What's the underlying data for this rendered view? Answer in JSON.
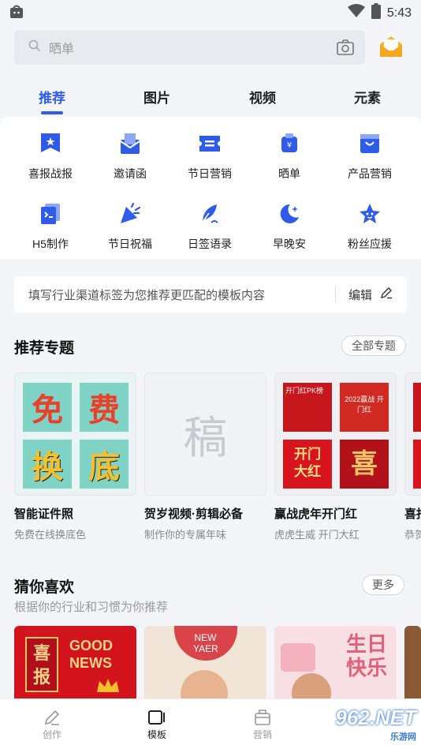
{
  "status": {
    "time": "5:43"
  },
  "search": {
    "placeholder": "晒单"
  },
  "tabs": [
    {
      "label": "推荐"
    },
    {
      "label": "图片"
    },
    {
      "label": "视频"
    },
    {
      "label": "元素"
    }
  ],
  "grid": [
    {
      "label": "喜报战报",
      "icon": "flag-icon"
    },
    {
      "label": "邀请函",
      "icon": "envelope-icon"
    },
    {
      "label": "节日营销",
      "icon": "ticket-icon"
    },
    {
      "label": "晒单",
      "icon": "receipt-icon"
    },
    {
      "label": "产品营销",
      "icon": "basket-icon"
    },
    {
      "label": "H5制作",
      "icon": "h5-icon"
    },
    {
      "label": "节日祝福",
      "icon": "party-popper-icon"
    },
    {
      "label": "日签语录",
      "icon": "quill-icon"
    },
    {
      "label": "早晚安",
      "icon": "moon-icon"
    },
    {
      "label": "粉丝应援",
      "icon": "star-icon"
    }
  ],
  "tag_bar": {
    "text": "填写行业渠道标签为您推荐更匹配的模板内容",
    "edit_label": "编辑"
  },
  "topics": {
    "title": "推荐专题",
    "all_label": "全部专题",
    "cards": [
      {
        "title": "智能证件照",
        "subtitle": "免费在线换底色",
        "chars": [
          "免",
          "费",
          "换",
          "底"
        ]
      },
      {
        "title": "贺岁视频·剪辑必备",
        "subtitle": "制作你的专属年味",
        "placeholder_char": "稿"
      },
      {
        "title": "赢战虎年开门红",
        "subtitle": "虎虎生威 开门大红",
        "tiles": [
          "开门红PK榜",
          "2022赢战 开门红",
          "开门 大红",
          "喜"
        ]
      },
      {
        "title": "喜报",
        "subtitle": "恭贺"
      }
    ]
  },
  "guess": {
    "title": "猜你喜欢",
    "subtitle": "根据你的行业和习惯为你推荐",
    "more_label": "更多",
    "items": [
      {
        "text1": "喜报",
        "text2": "GOOD NEWS"
      },
      {
        "text1": "NEW YAER"
      },
      {
        "text1": "生日快乐"
      }
    ]
  },
  "bottom_nav": [
    {
      "label": "创作",
      "icon": "pen-icon"
    },
    {
      "label": "模板",
      "icon": "template-icon"
    },
    {
      "label": "营销",
      "icon": "briefcase-icon"
    }
  ],
  "watermark": {
    "main": "962.NET",
    "sub": "乐游网"
  },
  "colors": {
    "accent": "#2f5bea",
    "bg": "#f4f5f9"
  }
}
